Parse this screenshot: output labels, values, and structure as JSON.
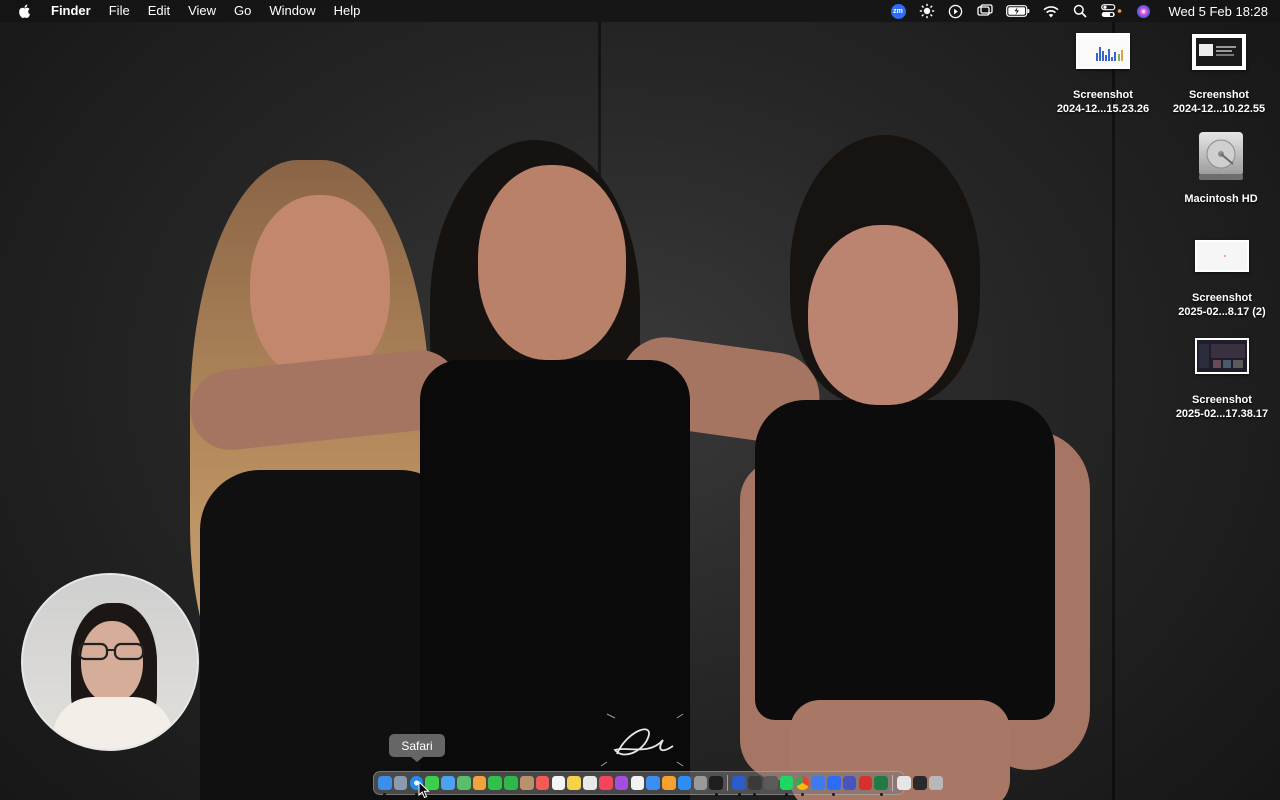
{
  "menubar": {
    "app_name": "Finder",
    "menus": [
      "File",
      "Edit",
      "View",
      "Go",
      "Window",
      "Help"
    ],
    "zoom_badge": "zm",
    "clock": "Wed 5 Feb  18:28",
    "status_icons": [
      "zoom-icon",
      "brightness-icon",
      "play-icon",
      "screen-mirroring-icon",
      "battery-icon",
      "wifi-icon",
      "search-icon",
      "control-center-icon",
      "siri-icon"
    ]
  },
  "desktop": {
    "icons": [
      {
        "line1": "Screenshot",
        "line2": "2024-12...15.23.26",
        "kind": "screenshot-chart"
      },
      {
        "line1": "Screenshot",
        "line2": "2024-12...10.22.55",
        "kind": "screenshot-window"
      },
      {
        "line1": "Macintosh HD",
        "line2": "",
        "kind": "hard-drive"
      },
      {
        "line1": "Screenshot",
        "line2": "2025-02...8.17 (2)",
        "kind": "screenshot-blank"
      },
      {
        "line1": "Screenshot",
        "line2": "2025-02...17.38.17",
        "kind": "screenshot-dark"
      }
    ]
  },
  "tooltip": {
    "label": "Safari"
  },
  "dock": {
    "items": [
      {
        "name": "finder",
        "color": "#3d8ee8",
        "running": true
      },
      {
        "name": "launchpad",
        "color": "#8a9bb0",
        "running": false
      },
      {
        "name": "safari",
        "color": "#1f8ef1",
        "running": true
      },
      {
        "name": "messages",
        "color": "#3ccf4e",
        "running": false
      },
      {
        "name": "mail",
        "color": "#4aa3f0",
        "running": false
      },
      {
        "name": "maps",
        "color": "#5bbd6a",
        "running": false
      },
      {
        "name": "photos",
        "color": "#f0a33a",
        "running": false
      },
      {
        "name": "facetime",
        "color": "#33c04a",
        "running": false
      },
      {
        "name": "phone",
        "color": "#2fb84a",
        "running": false
      },
      {
        "name": "contacts",
        "color": "#b8926a",
        "running": false
      },
      {
        "name": "calendar",
        "color": "#f25c54",
        "running": false
      },
      {
        "name": "reminders",
        "color": "#f4f4f4",
        "running": false
      },
      {
        "name": "notes",
        "color": "#f6d24a",
        "running": false
      },
      {
        "name": "freeform",
        "color": "#e9e9e9",
        "running": false
      },
      {
        "name": "music",
        "color": "#f5455c",
        "running": false
      },
      {
        "name": "podcasts",
        "color": "#a34ee0",
        "running": false
      },
      {
        "name": "news",
        "color": "#f2f2f2",
        "running": false
      },
      {
        "name": "keynote",
        "color": "#3c8ff0",
        "running": false
      },
      {
        "name": "pages",
        "color": "#f4a12e",
        "running": false
      },
      {
        "name": "app-store",
        "color": "#2f8ef6",
        "running": false
      },
      {
        "name": "settings",
        "color": "#9a9a9a",
        "running": false
      },
      {
        "name": "apple-tv",
        "color": "#1e1e1e",
        "running": true
      },
      {
        "name": "sep1",
        "color": "",
        "running": false
      },
      {
        "name": "word",
        "color": "#2b5cc9",
        "running": true
      },
      {
        "name": "capcut",
        "color": "#3a3a3a",
        "running": true
      },
      {
        "name": "davinci",
        "color": "#5a5a5a",
        "running": false
      },
      {
        "name": "spotify",
        "color": "#1ed760",
        "running": true
      },
      {
        "name": "chrome",
        "color": "#e8c23a",
        "running": true
      },
      {
        "name": "bluetooth",
        "color": "#3d7bf0",
        "running": false
      },
      {
        "name": "zoom",
        "color": "#2d6cf6",
        "running": true
      },
      {
        "name": "teams",
        "color": "#4b53bc",
        "running": false
      },
      {
        "name": "acrobat",
        "color": "#d8302a",
        "running": false
      },
      {
        "name": "excel",
        "color": "#1f7a44",
        "running": true
      },
      {
        "name": "sep2",
        "color": "",
        "running": false
      },
      {
        "name": "document",
        "color": "#e6e6e6",
        "running": false
      },
      {
        "name": "terminal",
        "color": "#2a2a2a",
        "running": false
      },
      {
        "name": "trash",
        "color": "#b8b8b8",
        "running": false
      }
    ]
  }
}
